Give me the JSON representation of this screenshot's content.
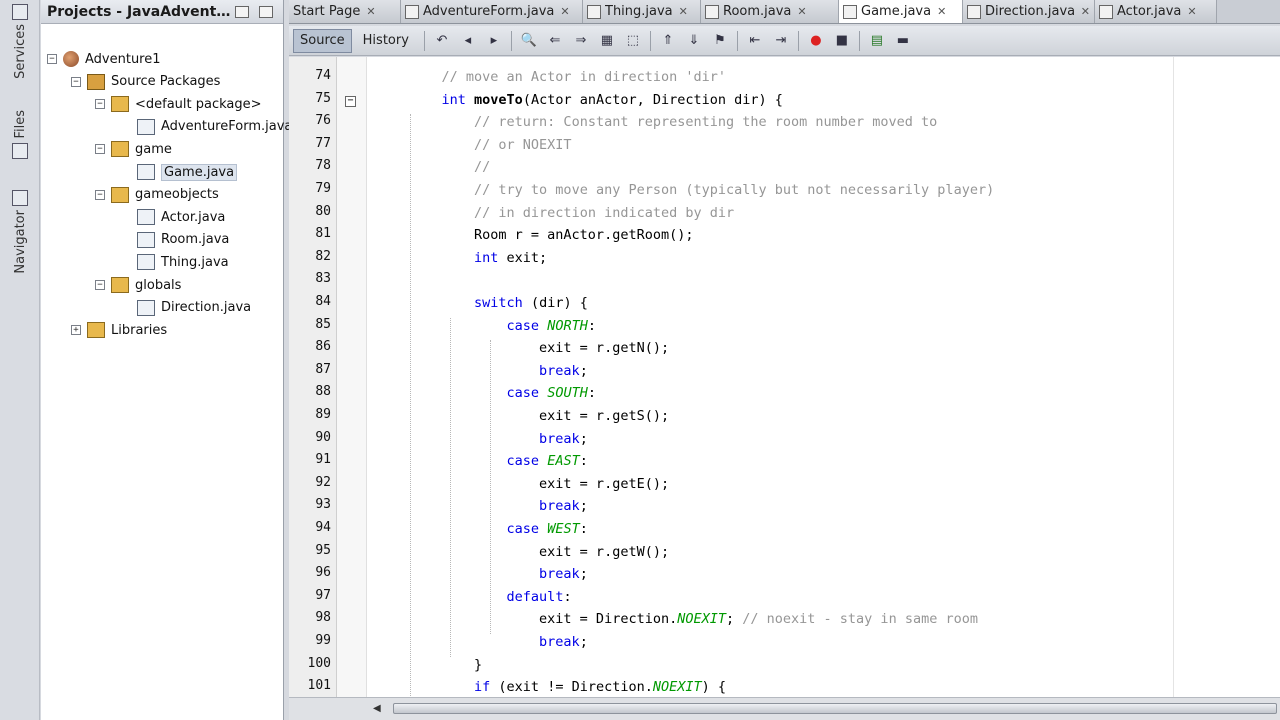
{
  "side_strip": {
    "tabs": [
      "Services",
      "Files",
      "Navigator"
    ]
  },
  "projects": {
    "title": "Projects - JavaAdvent…",
    "tree": [
      {
        "label": "Adventure1",
        "icon": "project-icon",
        "expander": "−"
      },
      {
        "label": "Source Packages",
        "icon": "source-packages-icon",
        "expander": "−"
      },
      {
        "label": "<default package>",
        "icon": "package-icon",
        "expander": "−"
      },
      {
        "label": "AdventureForm.java",
        "icon": "java-file-icon",
        "expander": ""
      },
      {
        "label": "game",
        "icon": "package-icon",
        "expander": "−"
      },
      {
        "label": "Game.java",
        "icon": "java-file-icon",
        "expander": "",
        "selected": true
      },
      {
        "label": "gameobjects",
        "icon": "package-icon",
        "expander": "−"
      },
      {
        "label": "Actor.java",
        "icon": "java-file-icon",
        "expander": ""
      },
      {
        "label": "Room.java",
        "icon": "java-file-icon",
        "expander": ""
      },
      {
        "label": "Thing.java",
        "icon": "java-file-icon",
        "expander": ""
      },
      {
        "label": "globals",
        "icon": "package-icon",
        "expander": "−"
      },
      {
        "label": "Direction.java",
        "icon": "java-file-icon",
        "expander": ""
      },
      {
        "label": "Libraries",
        "icon": "libraries-icon",
        "expander": "+"
      }
    ]
  },
  "tabs": [
    {
      "label": "Start Page",
      "active": false
    },
    {
      "label": "AdventureForm.java",
      "active": false
    },
    {
      "label": "Thing.java",
      "active": false
    },
    {
      "label": "Room.java",
      "active": false
    },
    {
      "label": "Game.java",
      "active": true
    },
    {
      "label": "Direction.java",
      "active": false
    },
    {
      "label": "Actor.java",
      "active": false
    }
  ],
  "toolbar": {
    "source_label": "Source",
    "history_label": "History"
  },
  "code": {
    "first_line_number": 74,
    "lines": [
      "    // move an Actor in direction 'dir'",
      "    int moveTo(Actor anActor, Direction dir) {",
      "        // return: Constant representing the room number moved to",
      "        // or NOEXIT",
      "        //",
      "        // try to move any Person (typically but not necessarily player)",
      "        // in direction indicated by dir",
      "        Room r = anActor.getRoom();",
      "        int exit;",
      "",
      "        switch (dir) {",
      "            case NORTH:",
      "                exit = r.getN();",
      "                break;",
      "            case SOUTH:",
      "                exit = r.getS();",
      "                break;",
      "            case EAST:",
      "                exit = r.getE();",
      "                break;",
      "            case WEST:",
      "                exit = r.getW();",
      "                break;",
      "            default:",
      "                exit = Direction.NOEXIT; // noexit - stay in same room",
      "                break;",
      "        }",
      "        if (exit != Direction.NOEXIT) {"
    ]
  },
  "colors": {
    "keyword": "#0000e6",
    "comment": "#969696",
    "enum_constant": "#009900"
  }
}
